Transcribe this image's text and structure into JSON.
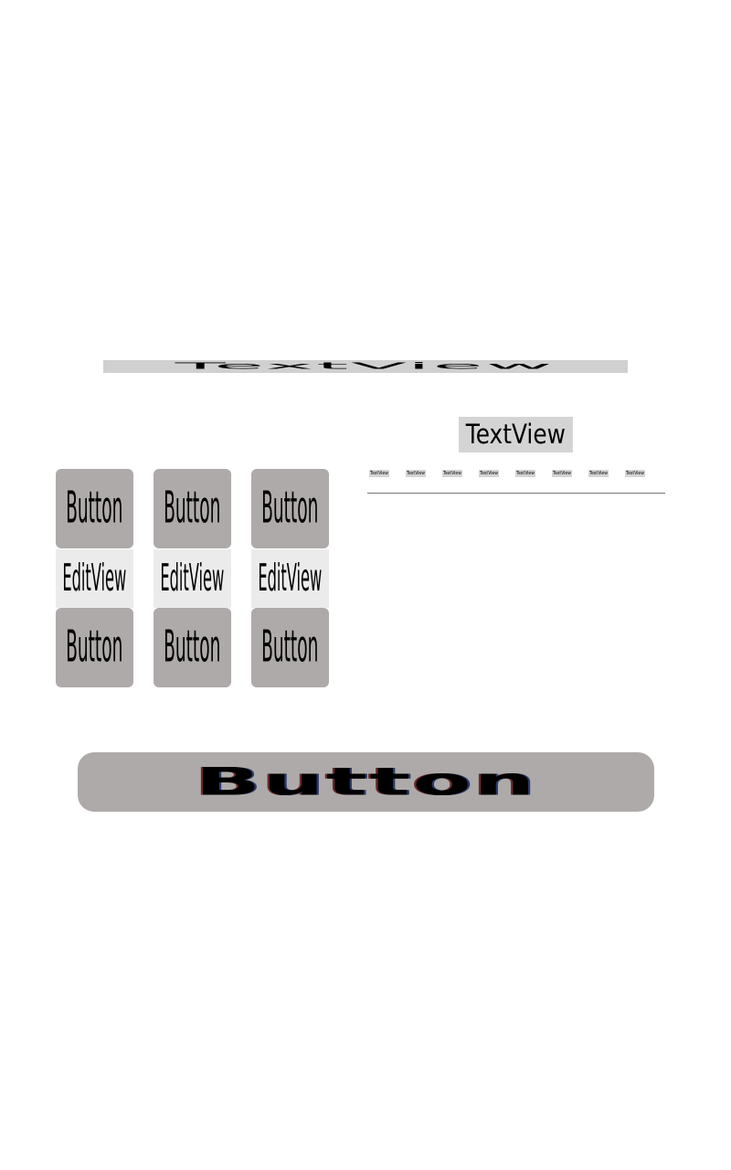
{
  "top_textview": {
    "label": "TextView"
  },
  "right_textview": {
    "label": "TextView"
  },
  "tiny_textviews": [
    "TextView",
    "TextView",
    "TextView",
    "TextView",
    "TextView",
    "TextView",
    "TextView",
    "TextView"
  ],
  "grid": {
    "top_buttons": [
      "Button",
      "Button",
      "Button"
    ],
    "edit_views": [
      "EditView",
      "EditView",
      "EditView"
    ],
    "bottom_buttons": [
      "Button",
      "Button",
      "Button"
    ]
  },
  "wide_button": {
    "label": "Button"
  }
}
